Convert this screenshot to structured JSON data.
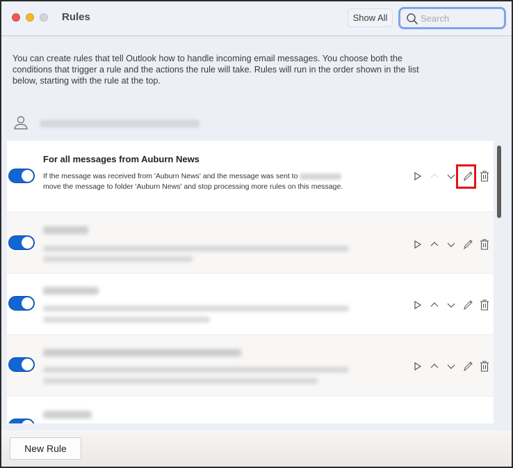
{
  "window": {
    "title": "Rules",
    "show_all_label": "Show All",
    "search": {
      "placeholder": "Search",
      "value": ""
    }
  },
  "description": "You can create rules that tell Outlook how to handle incoming email messages. You choose both the conditions that trigger a rule and the actions the rule will take. Rules will run in the order shown in the list below, starting with the rule at the top.",
  "account": {
    "icon": "person-icon",
    "email": "[redacted]"
  },
  "rules": [
    {
      "enabled": true,
      "title": "For all messages from Auburn News",
      "description_part1": "If the message was received from 'Auburn News' and the message was sent to",
      "description_part2": "move the message to folder 'Auburn News' and stop processing more rules on this message.",
      "redacted": false,
      "actions": {
        "run": "run-icon",
        "move_up_enabled": false,
        "move_down_enabled": true,
        "edit": "pencil-icon",
        "delete": "trash-icon"
      },
      "edit_highlighted": true
    },
    {
      "enabled": true,
      "title": "[redacted]",
      "redacted": true,
      "actions": {
        "move_up_enabled": true,
        "move_down_enabled": true
      }
    },
    {
      "enabled": true,
      "title": "[redacted]",
      "redacted": true,
      "actions": {
        "move_up_enabled": true,
        "move_down_enabled": true
      }
    },
    {
      "enabled": true,
      "title": "[redacted]",
      "redacted": true,
      "actions": {
        "move_up_enabled": true,
        "move_down_enabled": true
      }
    },
    {
      "enabled": true,
      "title": "[redacted]",
      "redacted": true,
      "actions": {
        "move_up_enabled": true,
        "move_down_enabled": true
      }
    }
  ],
  "footer": {
    "new_rule_label": "New Rule"
  },
  "colors": {
    "toggle_on": "#1166d4",
    "highlight": "#e8101a",
    "search_focus": "#7fa4e8"
  }
}
